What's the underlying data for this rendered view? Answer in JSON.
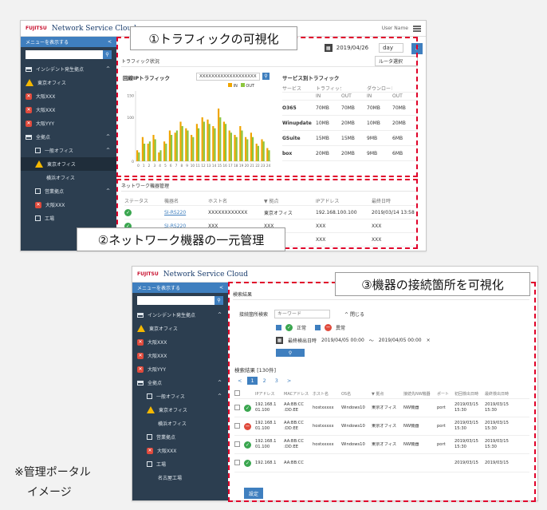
{
  "screen1": {
    "app_title": "Network Service Cloud",
    "user": "User Name",
    "side_header": "メニューを表示する",
    "side_items": [
      {
        "icon": "tree",
        "label": "インシデント発生拠点",
        "caret": "^"
      },
      {
        "icon": "warn",
        "label": "東京オフィス"
      },
      {
        "icon": "err",
        "label": "大阪XXX"
      },
      {
        "icon": "err",
        "label": "大阪XXX"
      },
      {
        "icon": "err",
        "label": "大阪YYY"
      },
      {
        "icon": "tree",
        "label": "全拠点",
        "caret": "^"
      },
      {
        "icon": "box",
        "label": "一般オフィス",
        "caret": "^"
      },
      {
        "icon": "warn",
        "label": "東京オフィス",
        "selected": true
      },
      {
        "icon": "none",
        "label": "横浜オフィス"
      },
      {
        "icon": "box",
        "label": "営業拠点",
        "caret": "^"
      },
      {
        "icon": "err",
        "label": "大阪XXX"
      },
      {
        "icon": "box",
        "label": "工場"
      }
    ],
    "date": "2019/04/26",
    "period": "day",
    "panel_title": "トラフィック状況",
    "router_select": "ルータ選択",
    "traffic_title": "回線IPトラフィック",
    "traffic_field": "XXXXXXXXXXXXXXXXXXX",
    "legend": [
      "IN",
      "OUT"
    ],
    "service_title": "サービス別トラフィック",
    "service_headers": [
      "サービス",
      "トラフィック総量",
      "",
      "ダウンロード量",
      ""
    ],
    "service_sub": [
      "",
      "IN",
      "OUT",
      "IN",
      "OUT"
    ],
    "service_rows": [
      [
        "O365",
        "70MB",
        "70MB",
        "70MB",
        "70MB"
      ],
      [
        "Winupdate",
        "10MB",
        "20MB",
        "10MB",
        "20MB"
      ],
      [
        "GSuite",
        "15MB",
        "15MB",
        "9MB",
        "6MB"
      ],
      [
        "box",
        "20MB",
        "20MB",
        "9MB",
        "6MB"
      ]
    ],
    "x_ticks": [
      "0",
      "1",
      "2",
      "3",
      "4",
      "5",
      "6",
      "7",
      "8",
      "9",
      "10",
      "11",
      "12",
      "13",
      "14",
      "15",
      "16",
      "17",
      "18",
      "19",
      "20",
      "21",
      "22",
      "23",
      "24"
    ],
    "network_title": "ネットワーク機器管理",
    "net_headers": [
      "ステータス",
      "機器名",
      "ホスト名",
      "▼ 拠点",
      "IPアドレス",
      "最終日時"
    ],
    "net_rows": [
      [
        "ok",
        "SI-RS220",
        "XXXXXXXXXXXX",
        "東京オフィス",
        "192.168.100.100",
        "2019/03/14 13:58"
      ],
      [
        "ok",
        "SI-RS220",
        "XXX",
        "XXX",
        "XXX",
        "XXX"
      ],
      [
        "ok",
        "",
        "",
        "",
        "XXX",
        "XXX"
      ]
    ]
  },
  "screen2": {
    "app_title": "Network Service Cloud",
    "side_header": "メニューを表示する",
    "side_items": [
      {
        "icon": "tree",
        "label": "インシデント発生拠点",
        "caret": "^"
      },
      {
        "icon": "warn",
        "label": "東京オフィス"
      },
      {
        "icon": "err",
        "label": "大阪XXX"
      },
      {
        "icon": "err",
        "label": "大阪XXX"
      },
      {
        "icon": "err",
        "label": "大阪YYY"
      },
      {
        "icon": "tree",
        "label": "全拠点",
        "caret": "^"
      },
      {
        "icon": "box",
        "label": "一般オフィス",
        "caret": "^"
      },
      {
        "icon": "warn",
        "label": "東京オフィス"
      },
      {
        "icon": "none",
        "label": "横浜オフィス"
      },
      {
        "icon": "box",
        "label": "営業拠点"
      },
      {
        "icon": "err",
        "label": "大阪XXX"
      },
      {
        "icon": "box",
        "label": "工場"
      },
      {
        "icon": "none",
        "label": "名古屋工場"
      }
    ],
    "panel_title": "検索結果",
    "search_label": "接続箇所検索",
    "search_placeholder": "キーワード",
    "collapse": "^ 閉じる",
    "filter_normal": "正常",
    "filter_abnormal": "異常",
    "date_label": "最終検出日時",
    "date_from": "2019/04/05 00:00",
    "date_sep": "〜",
    "date_to": "2019/04/05 00:00",
    "clear": "×",
    "result_count": "検索結果 [130件]",
    "pages": [
      "<",
      "1",
      "2",
      "3",
      ">"
    ],
    "headers": [
      "",
      "",
      "IPアドレス",
      "MACアドレス",
      "ホスト名",
      "OS名",
      "▼ 拠点",
      "接続先NW機器",
      "ポート",
      "初回検出日時",
      "最終検出日時"
    ],
    "rows": [
      [
        "ok",
        "192.168.1\n01.100",
        "AA:BB:CC\n:DD:EE",
        "hostxxxxx",
        "Windows10",
        "東京オフィス",
        "NW機器",
        "port",
        "2019/03/15\n15:30",
        "2019/03/15\n15:30"
      ],
      [
        "ng",
        "192.168.1\n01.100",
        "AA:BB:CC\n:DD:EE",
        "hostxxxxx",
        "Windows10",
        "東京オフィス",
        "NW機器",
        "port",
        "2019/03/15\n15:30",
        "2019/03/15\n15:30"
      ],
      [
        "ok",
        "192.168.1\n01.100",
        "AA:BB:CC\n:DD:EE",
        "hostxxxxx",
        "Windows10",
        "東京オフィス",
        "NW機器",
        "port",
        "2019/03/15\n15:30",
        "2019/03/15\n15:30"
      ],
      [
        "ok",
        "192.168.1",
        "AA:BB:CC",
        "",
        "",
        "",
        "",
        "",
        "2019/03/15",
        "2019/03/15"
      ]
    ],
    "action_button": "設定"
  },
  "callouts": {
    "c1": "①トラフィックの可視化",
    "c2": "②ネットワーク機器の一元管理",
    "c3": "③機器の接続箇所を可視化"
  },
  "note": {
    "line1": "※管理ポータル",
    "line2": "イメージ"
  },
  "colors": {
    "in": "#f0a500",
    "out": "#8cc63f",
    "accent": "#3f7fbf",
    "dash": "#e0002a"
  },
  "chart_data": {
    "type": "bar",
    "title": "回線IPトラフィック",
    "categories": [
      "0",
      "1",
      "2",
      "3",
      "4",
      "5",
      "6",
      "7",
      "8",
      "9",
      "10",
      "11",
      "12",
      "13",
      "14",
      "15",
      "16",
      "17",
      "18",
      "19",
      "20",
      "21",
      "22",
      "23",
      "24"
    ],
    "series": [
      {
        "name": "IN",
        "values": [
          25,
          55,
          40,
          60,
          20,
          45,
          70,
          65,
          90,
          75,
          60,
          85,
          100,
          95,
          80,
          120,
          90,
          70,
          60,
          80,
          55,
          65,
          40,
          50,
          30
        ]
      },
      {
        "name": "OUT",
        "values": [
          20,
          40,
          45,
          50,
          25,
          40,
          60,
          70,
          80,
          70,
          55,
          75,
          90,
          85,
          75,
          100,
          85,
          65,
          55,
          70,
          50,
          55,
          35,
          45,
          25
        ]
      }
    ],
    "ylim": [
      0,
      160
    ],
    "y_ticks": [
      "0",
      "100",
      "150"
    ]
  }
}
